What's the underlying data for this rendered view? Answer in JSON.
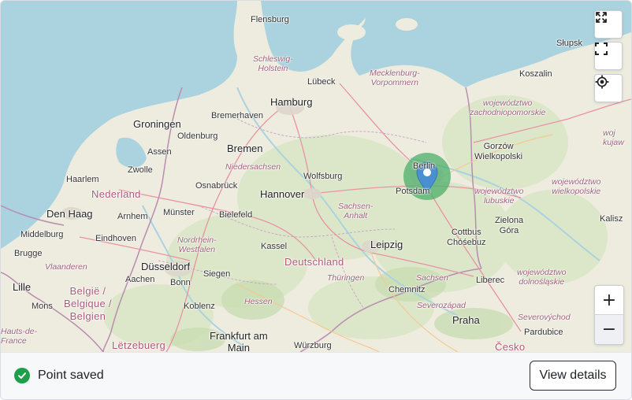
{
  "map": {
    "labels": {
      "flensburg": "Flensburg",
      "schleswig_holstein": "Schleswig-\nHolstein",
      "lubeck": "Lübeck",
      "mecklenburg": "Mecklenburg-\nVorpommern",
      "hamburg": "Hamburg",
      "bremerhaven": "Bremerhaven",
      "groningen": "Groningen",
      "oldenburg": "Oldenburg",
      "bremen": "Bremen",
      "assen": "Assen",
      "zwolle": "Zwolle",
      "niedersachsen": "Niedersachsen",
      "wolfsburg": "Wolfsburg",
      "haarlem": "Haarlem",
      "nederland": "Nederland",
      "osnabruck": "Osnabrück",
      "hannover": "Hannover",
      "berlin": "Berlin",
      "potsdam": "Potsdam",
      "den_haag": "Den Haag",
      "arnhem": "Arnhem",
      "munster": "Münster",
      "bielefeld": "Bielefeld",
      "sachsen_anhalt": "Sachsen-\nAnhalt",
      "middelburg": "Middelburg",
      "eindhoven": "Eindhoven",
      "nrw": "Nordrhein-\nWestfalen",
      "kassel": "Kassel",
      "leipzig": "Leipzig",
      "brugge": "Brugge",
      "vlaanderen": "Vlaanderen",
      "dusseldorf": "Düsseldorf",
      "deutschland": "Deutschland",
      "siegen": "Siegen",
      "thuringen": "Thüringen",
      "sachsen": "Sachsen",
      "lille": "Lille",
      "aachen": "Aachen",
      "bonn": "Bonn",
      "chemnitz": "Chemnitz",
      "belgie": "België /\nBelgique /\nBelgien",
      "mons": "Mons",
      "hessen": "Hessen",
      "koblenz": "Koblenz",
      "severozapad": "Severozápad",
      "hauts_de_france": "Hauts-de-\nFrance",
      "frankfurt": "Frankfurt am\nMain",
      "wurzburg": "Würzburg",
      "praha": "Praha",
      "letzebuerg": "Lëtzebuerg",
      "cesko": "Česko",
      "slupsk": "Słupsk",
      "koszalin": "Koszalin",
      "zachodniopomorskie": "województwo\nzachodniopomorskie",
      "gorzow": "Gorzów\nWielkopolski",
      "lubuskie": "województwo\nlubuskie",
      "wielkopolskie": "województwo\nwielkopolskie",
      "kujaw": "woj\nkujaw",
      "zielona_gora": "Zielona\nGóra",
      "kalisz": "Kalisz",
      "cottbus": "Cottbus\nChóśebuz",
      "dolnoslaskie": "województwo\ndolnośląskie",
      "liberec": "Liberec",
      "severovychod": "Severovýchod",
      "pardubice": "Pardubice"
    }
  },
  "controls": {
    "expand_icon": "expand-arrows-icon",
    "fullscreen_icon": "fullscreen-icon",
    "locate_icon": "locate-icon",
    "zoom_in": "+",
    "zoom_out": "−"
  },
  "footer": {
    "status_text": "Point saved",
    "status_color": "#1e9e4a",
    "button_label": "View details"
  },
  "marker": {
    "color": "#4a90d0",
    "halo_color": "#4caf6a"
  }
}
